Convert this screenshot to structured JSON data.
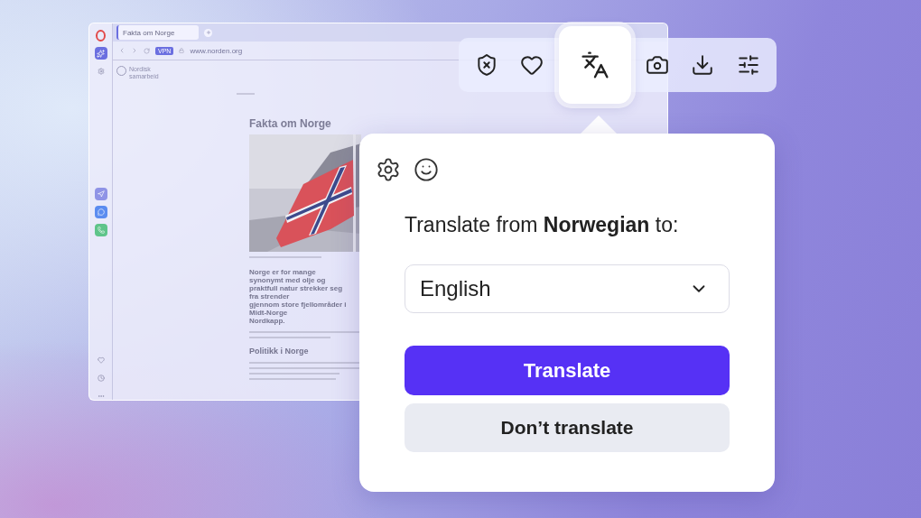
{
  "browser": {
    "tab_title": "Fakta om Norge",
    "vpn_badge": "VPN",
    "url": "www.norden.org",
    "site_name": "Nordisk samarbeid",
    "heading": "Fakta om Norge",
    "lead_lines": [
      "Norge er for mange synonymt med olje og",
      "praktfull natur strekker seg fra strender",
      "gjennom store fjellområder i Midt-Norge",
      "Nordkapp."
    ],
    "section": "Politikk i Norge"
  },
  "toolbar": {
    "buttons": [
      {
        "kind": "shield",
        "selected": false
      },
      {
        "kind": "heart",
        "selected": false
      },
      {
        "kind": "translate",
        "selected": true
      },
      {
        "kind": "camera",
        "selected": false
      },
      {
        "kind": "download",
        "selected": false
      },
      {
        "kind": "sliders",
        "selected": false
      }
    ]
  },
  "popup": {
    "prompt": "Translate from **Norwegian** to:",
    "language": "English",
    "primary_button": "Translate",
    "secondary_button": "Don’t translate"
  }
}
